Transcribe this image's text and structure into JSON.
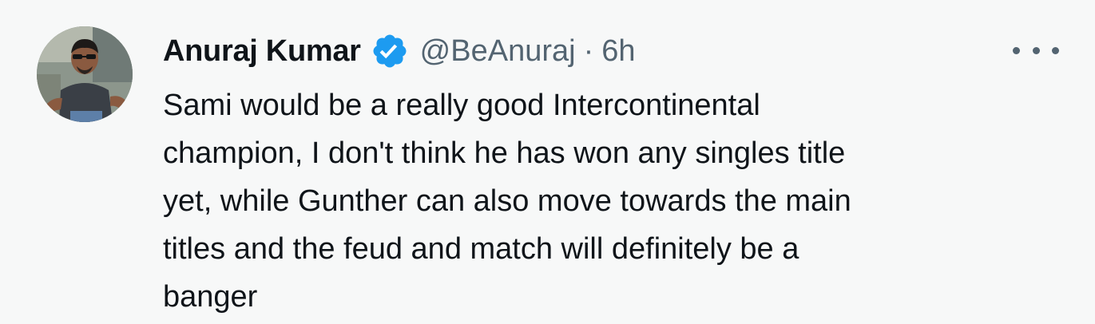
{
  "tweet": {
    "author": {
      "display_name": "Anuraj Kumar",
      "handle": "@BeAnuraj",
      "verified": true,
      "avatar_icon": "profile-photo-avatar"
    },
    "separator": "·",
    "time": "6h",
    "body_lines": [
      "Sami would be a really good Intercontinental",
      "champion, I don't think he has won any singles title",
      "yet, while Gunther can also move towards the main",
      "titles and the feud and match will definitely be a",
      "banger"
    ],
    "more_icon": "more-options-icon"
  },
  "colors": {
    "background": "#f7f8f8",
    "text_primary": "#0f1419",
    "text_secondary": "#536471",
    "verified_badge": "#1d9bf0"
  }
}
